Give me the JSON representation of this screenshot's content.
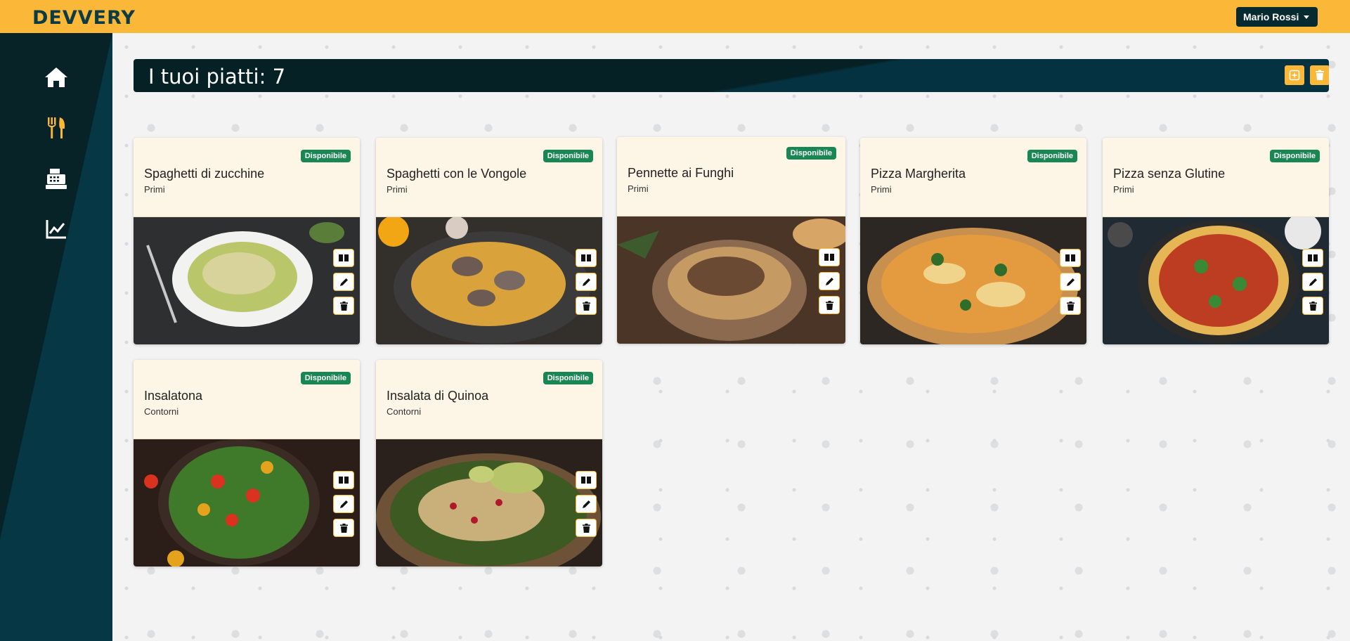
{
  "brand": {
    "logo_text": "DEVVERY"
  },
  "user": {
    "name": "Mario Rossi"
  },
  "sidebar": {
    "items": [
      {
        "icon": "home-icon"
      },
      {
        "icon": "utensils-icon"
      },
      {
        "icon": "cash-register-icon"
      },
      {
        "icon": "chart-line-icon"
      }
    ]
  },
  "header": {
    "title": "I tuoi piatti: 7",
    "add_icon": "add-icon",
    "delete_icon": "trash-icon"
  },
  "dishes": [
    {
      "name": "Spaghetti di zucchine",
      "category": "Primi",
      "status": "Disponibile"
    },
    {
      "name": "Spaghetti con le Vongole",
      "category": "Primi",
      "status": "Disponibile"
    },
    {
      "name": "Pennette ai Funghi",
      "category": "Primi",
      "status": "Disponibile"
    },
    {
      "name": "Pizza Margherita",
      "category": "Primi",
      "status": "Disponibile"
    },
    {
      "name": "Pizza senza Glutine",
      "category": "Primi",
      "status": "Disponibile"
    },
    {
      "name": "Insalatona",
      "category": "Contorni",
      "status": "Disponibile"
    },
    {
      "name": "Insalata di Quinoa",
      "category": "Contorni",
      "status": "Disponibile"
    }
  ],
  "colors": {
    "accent": "#fbb737",
    "dark": "#082327",
    "success": "#198754",
    "card_header": "#fdf5e6"
  }
}
